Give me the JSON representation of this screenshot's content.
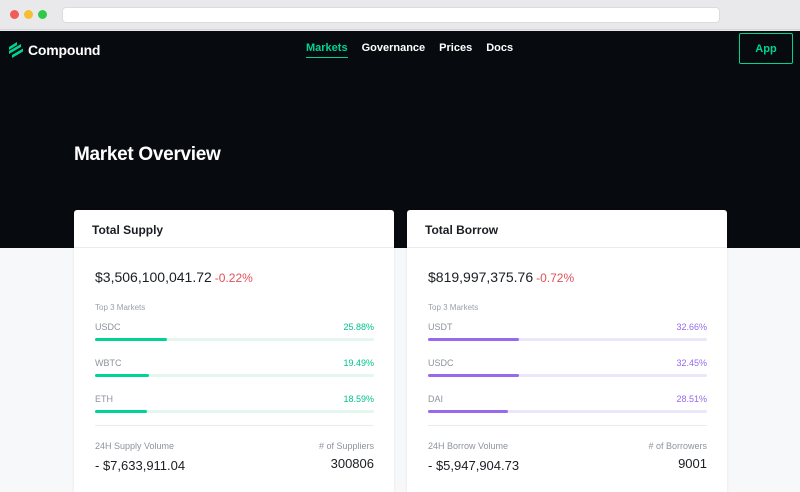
{
  "brand": {
    "name": "Compound",
    "accent": "#00d395",
    "borrow_accent": "#9669ed",
    "negative": "#e0505b"
  },
  "nav": {
    "items": [
      "Markets",
      "Governance",
      "Prices",
      "Docs"
    ],
    "active": "Markets"
  },
  "app_button": "App",
  "page_title": "Market Overview",
  "supply": {
    "title": "Total Supply",
    "total": "$3,506,100,041.72",
    "change": "-0.22%",
    "top_label": "Top 3 Markets",
    "markets": [
      {
        "name": "USDC",
        "pct": "25.88%",
        "share": 25.88
      },
      {
        "name": "WBTC",
        "pct": "19.49%",
        "share": 19.49
      },
      {
        "name": "ETH",
        "pct": "18.59%",
        "share": 18.59
      }
    ],
    "volume_label": "24H Supply Volume",
    "volume": "- $7,633,911.04",
    "count_label": "# of Suppliers",
    "count": "300806"
  },
  "borrow": {
    "title": "Total Borrow",
    "total": "$819,997,375.76",
    "change": "-0.72%",
    "top_label": "Top 3 Markets",
    "markets": [
      {
        "name": "USDT",
        "pct": "32.66%",
        "share": 32.66
      },
      {
        "name": "USDC",
        "pct": "32.45%",
        "share": 32.45
      },
      {
        "name": "DAI",
        "pct": "28.51%",
        "share": 28.51
      }
    ],
    "volume_label": "24H Borrow Volume",
    "volume": "- $5,947,904.73",
    "count_label": "# of Borrowers",
    "count": "9001"
  }
}
